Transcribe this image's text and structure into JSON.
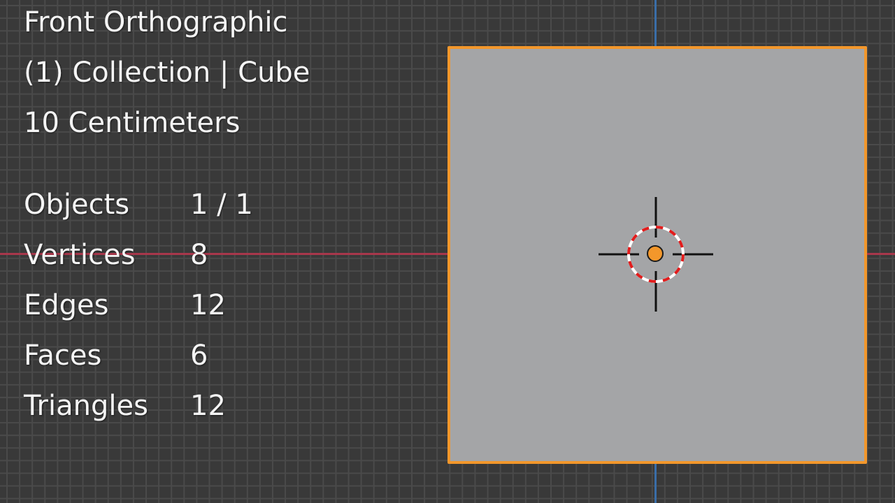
{
  "viewport": {
    "view_name": "Front Orthographic",
    "collection_info": "(1) Collection | Cube",
    "grid_scale": "10 Centimeters"
  },
  "statistics": [
    {
      "label": "Objects",
      "value": "1 / 1"
    },
    {
      "label": "Vertices",
      "value": "8"
    },
    {
      "label": "Edges",
      "value": "12"
    },
    {
      "label": "Faces",
      "value": "6"
    },
    {
      "label": "Triangles",
      "value": "12"
    }
  ],
  "colors": {
    "background": "#393939",
    "grid_line": "#4a4a4a",
    "x_axis": "#a8374b",
    "z_axis": "#3a6ea8",
    "selection_outline": "#f3972b",
    "object_face": "#a4a5a7",
    "object_origin": "#f3972b"
  },
  "icons": {
    "cursor": "3d-cursor-icon",
    "origin": "object-origin-icon"
  }
}
